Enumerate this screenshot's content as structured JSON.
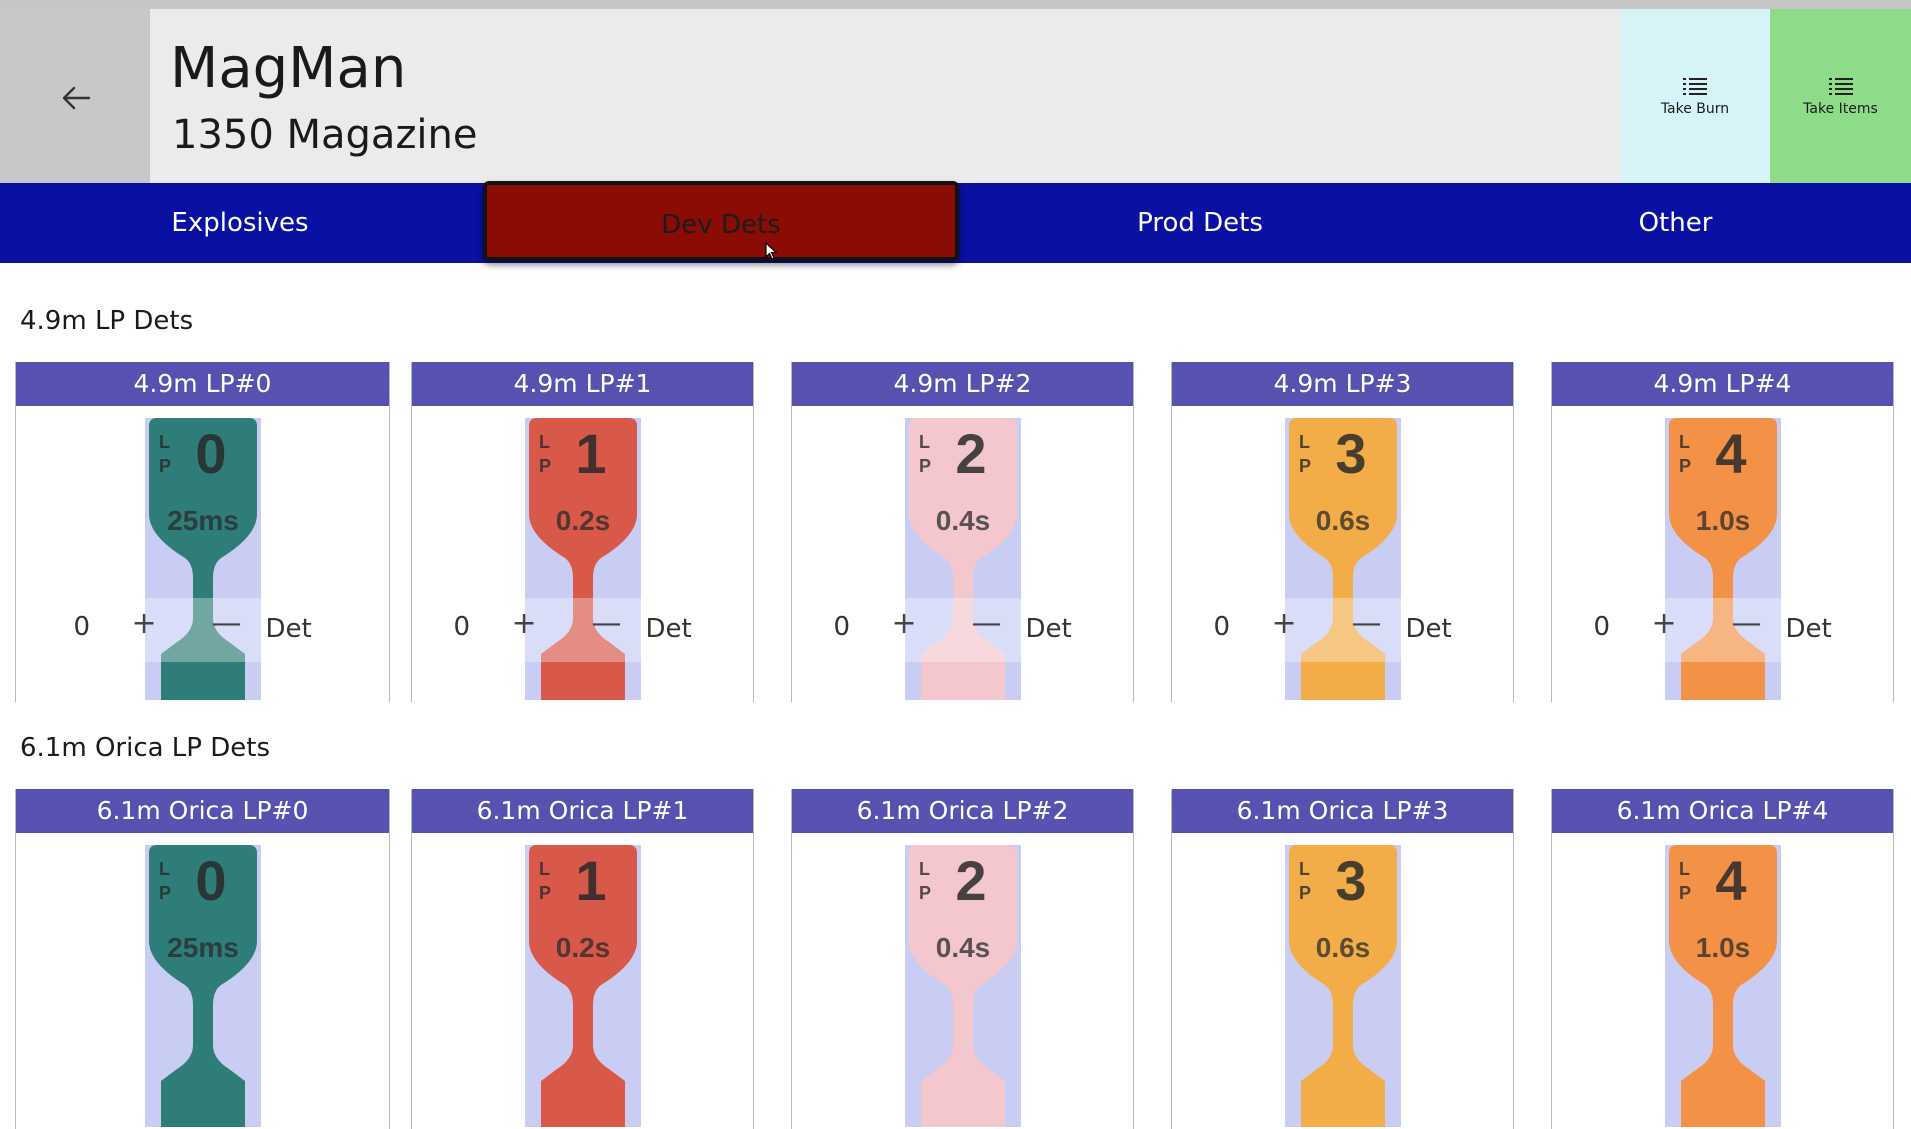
{
  "header": {
    "title": "MagMan",
    "subtitle": "1350 Magazine",
    "back_icon": "arrow-left-icon",
    "take_burn_label": "Take Burn",
    "take_items_label": "Take Items",
    "list_icon": "list-icon"
  },
  "tabs": [
    {
      "label": "Explosives",
      "active": false
    },
    {
      "label": "Dev Dets",
      "active": true
    },
    {
      "label": "Prod Dets",
      "active": false
    },
    {
      "label": "Other",
      "active": false
    }
  ],
  "colors": {
    "tab_bar": "#0a10a2",
    "tab_active": "#8b0c05",
    "card_header": "#5752b0",
    "take_burn_bg": "#d6f3f7",
    "take_items_bg": "#8edb8a"
  },
  "sections": [
    {
      "title": "4.9m LP Dets",
      "items": [
        {
          "name": "4.9m LP#0",
          "count": "0",
          "unit": "Det",
          "plus": "+",
          "minus": "—",
          "tag_number": "0",
          "tag_delay": "25ms",
          "tag_letters": [
            "L",
            "P"
          ],
          "color": "#2e7d78"
        },
        {
          "name": "4.9m LP#1",
          "count": "0",
          "unit": "Det",
          "plus": "+",
          "minus": "—",
          "tag_number": "1",
          "tag_delay": "0.2s",
          "tag_letters": [
            "L",
            "P"
          ],
          "color": "#d8584a"
        },
        {
          "name": "4.9m LP#2",
          "count": "0",
          "unit": "Det",
          "plus": "+",
          "minus": "—",
          "tag_number": "2",
          "tag_delay": "0.4s",
          "tag_letters": [
            "L",
            "P"
          ],
          "color": "#f3c7cd"
        },
        {
          "name": "4.9m LP#3",
          "count": "0",
          "unit": "Det",
          "plus": "+",
          "minus": "—",
          "tag_number": "3",
          "tag_delay": "0.6s",
          "tag_letters": [
            "L",
            "P"
          ],
          "color": "#f2ad48"
        },
        {
          "name": "4.9m LP#4",
          "count": "0",
          "unit": "Det",
          "plus": "+",
          "minus": "—",
          "tag_number": "4",
          "tag_delay": "1.0s",
          "tag_letters": [
            "L",
            "P"
          ],
          "color": "#f39246"
        }
      ]
    },
    {
      "title": "6.1m Orica LP Dets",
      "items": [
        {
          "name": "6.1m Orica LP#0",
          "tag_number": "0",
          "tag_delay": "25ms",
          "tag_letters": [
            "L",
            "P"
          ],
          "color": "#2e7d78"
        },
        {
          "name": "6.1m Orica LP#1",
          "tag_number": "1",
          "tag_delay": "0.2s",
          "tag_letters": [
            "L",
            "P"
          ],
          "color": "#d8584a"
        },
        {
          "name": "6.1m Orica LP#2",
          "tag_number": "2",
          "tag_delay": "0.4s",
          "tag_letters": [
            "L",
            "P"
          ],
          "color": "#f3c7cd"
        },
        {
          "name": "6.1m Orica LP#3",
          "tag_number": "3",
          "tag_delay": "0.6s",
          "tag_letters": [
            "L",
            "P"
          ],
          "color": "#f2ad48"
        },
        {
          "name": "6.1m Orica LP#4",
          "tag_number": "4",
          "tag_delay": "1.0s",
          "tag_letters": [
            "L",
            "P"
          ],
          "color": "#f39246"
        }
      ]
    }
  ]
}
